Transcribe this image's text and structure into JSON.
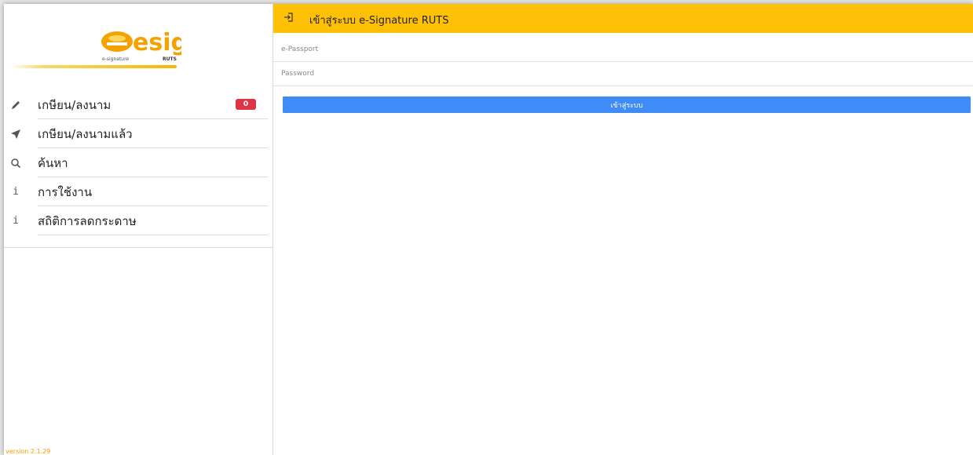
{
  "logo": {
    "main_text": "esign",
    "tagline": "e-signature",
    "brand": "RUTS"
  },
  "sidebar": {
    "items": [
      {
        "label": "เกษียน/ลงนาม",
        "icon": "pencil-icon",
        "badge": "0"
      },
      {
        "label": "เกษียน/ลงนามแล้ว",
        "icon": "paper-plane-icon"
      },
      {
        "label": "ค้นหา",
        "icon": "search-icon"
      },
      {
        "label": "การใช้งาน",
        "icon": "info-icon"
      },
      {
        "label": "สถิติการลดกระดาษ",
        "icon": "info-icon"
      }
    ],
    "version": "version 2.1.29"
  },
  "header": {
    "title": "เข้าสู่ระบบ e-Signature RUTS",
    "icon": "sign-in-icon"
  },
  "form": {
    "passport_placeholder": "e-Passport",
    "password_placeholder": "Password",
    "login_label": "เข้าสู่ระบบ"
  },
  "colors": {
    "header_bg": "#ffc107",
    "login_button": "#3f8cf6",
    "badge_bg": "#dc3545",
    "version_text": "#f0a000",
    "logo_orange": "#f5a200"
  }
}
